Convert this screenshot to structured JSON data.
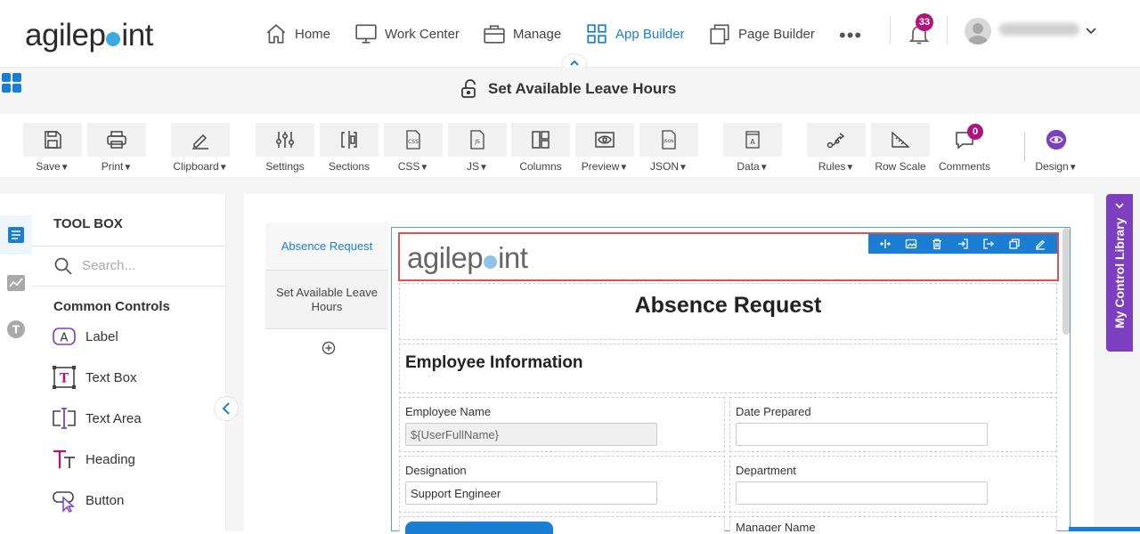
{
  "header": {
    "logo_left": "agilep",
    "logo_right": "int",
    "nav": [
      {
        "label": "Home",
        "icon": "home-icon"
      },
      {
        "label": "Work Center",
        "icon": "monitor-icon"
      },
      {
        "label": "Manage",
        "icon": "briefcase-icon"
      },
      {
        "label": "App Builder",
        "icon": "grid-icon",
        "active": true
      },
      {
        "label": "Page Builder",
        "icon": "copy-pages-icon"
      }
    ],
    "more": "•••",
    "notifications_count": "33",
    "accent_color": "#1a7fd4",
    "badge_color": "#b0137d"
  },
  "title_bar": {
    "form_name": "Set Available Leave Hours"
  },
  "toolbar": {
    "buttons": [
      {
        "label": "Save",
        "dropdown": true
      },
      {
        "label": "Print",
        "dropdown": true
      },
      {
        "label": "Clipboard",
        "dropdown": true
      },
      {
        "label": "Settings",
        "dropdown": false
      },
      {
        "label": "Sections",
        "dropdown": false
      },
      {
        "label": "CSS",
        "dropdown": true
      },
      {
        "label": "JS",
        "dropdown": true
      },
      {
        "label": "Columns",
        "dropdown": false
      },
      {
        "label": "Preview",
        "dropdown": true
      },
      {
        "label": "JSON",
        "dropdown": true
      },
      {
        "label": "Data",
        "dropdown": true
      },
      {
        "label": "Rules",
        "dropdown": true
      },
      {
        "label": "Row Scale",
        "dropdown": false
      },
      {
        "label": "Comments",
        "dropdown": false
      },
      {
        "label": "Design",
        "dropdown": true
      }
    ],
    "comments_count": "0",
    "css_icon_text": "CSS",
    "js_icon_text": "JS",
    "json_icon_text": "JSON",
    "data_icon_text": "A",
    "design_color": "#7b3fbf"
  },
  "toolbox": {
    "title": "TOOL BOX",
    "search_placeholder": "Search...",
    "group": "Common Controls",
    "items": [
      {
        "label": "Label",
        "icon": "label-icon",
        "icon_text": "A"
      },
      {
        "label": "Text Box",
        "icon": "textbox-icon",
        "icon_text": "T"
      },
      {
        "label": "Text Area",
        "icon": "textarea-icon"
      },
      {
        "label": "Heading",
        "icon": "heading-icon"
      },
      {
        "label": "Button",
        "icon": "button-icon"
      }
    ],
    "rail_t": "T"
  },
  "pages": [
    {
      "label": "Absence Request",
      "active": true
    },
    {
      "label": "Set Available Leave Hours",
      "active": false
    }
  ],
  "form": {
    "logo_left": "agilep",
    "logo_right": "int",
    "title": "Absence Request",
    "section_title": "Employee Information",
    "fields": {
      "employee_name_label": "Employee Name",
      "employee_name_value": "${UserFullName}",
      "date_prepared_label": "Date Prepared",
      "date_prepared_value": "",
      "designation_label": "Designation",
      "designation_value": "Support Engineer",
      "department_label": "Department",
      "department_value": "",
      "cut_label": "Manager Name"
    }
  },
  "right_panel": {
    "label": "My Control Library"
  }
}
